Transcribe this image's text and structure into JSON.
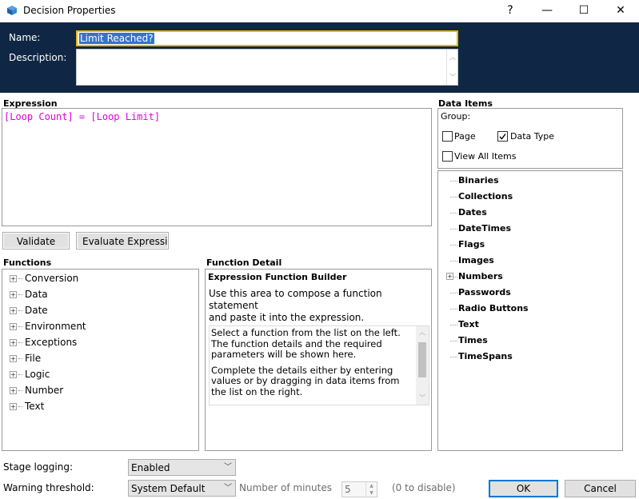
{
  "window": {
    "title": "Decision Properties",
    "help_label": "?",
    "minimize_label": "—",
    "maximize_label": "☐",
    "close_label": "✕"
  },
  "header": {
    "name_label": "Name:",
    "name_value": "Limit Reached?",
    "description_label": "Description:",
    "description_value": ""
  },
  "expression": {
    "label": "Expression",
    "value": "[Loop Count] = [Loop Limit]",
    "validate_label": "Validate",
    "evaluate_label": "Evaluate Expressi"
  },
  "functions": {
    "label": "Functions",
    "items": [
      "Conversion",
      "Data",
      "Date",
      "Environment",
      "Exceptions",
      "File",
      "Logic",
      "Number",
      "Text"
    ]
  },
  "function_detail": {
    "label": "Function Detail",
    "heading": "Expression Function Builder",
    "intro_line1": "Use this area to compose a function statement",
    "intro_line2": "and paste it into the expression.",
    "para1_line1": "Select a function from the list on the left.",
    "para1_line2": "The function details and the required",
    "para1_line3": "parameters will be shown here.",
    "para2_line1": "Complete the details either by entering",
    "para2_line2": "values or by dragging in data items from",
    "para2_line3": "the list on the right."
  },
  "data_items": {
    "label": "Data Items",
    "group_label": "Group:",
    "page_label": "Page",
    "page_checked": false,
    "data_type_label": "Data Type",
    "data_type_checked": true,
    "view_all_label": "View All Items",
    "view_all_checked": false,
    "items": [
      "Binaries",
      "Collections",
      "Dates",
      "DateTimes",
      "Flags",
      "Images",
      "Numbers",
      "Passwords",
      "Radio Buttons",
      "Text",
      "Times",
      "TimeSpans"
    ],
    "expandable_item": "Numbers"
  },
  "footer": {
    "stage_logging_label": "Stage logging:",
    "stage_logging_value": "Enabled",
    "warning_threshold_label": "Warning threshold:",
    "warning_threshold_value": "System Default",
    "number_of_minutes_label": "Number of minutes",
    "minutes_value": "5",
    "disable_hint": "(0 to disable)",
    "ok_label": "OK",
    "cancel_label": "Cancel"
  },
  "colors": {
    "header_bg": "#0f2744",
    "name_border": "#f0b400",
    "selection": "#3173cf",
    "expression_text": "#e000e0",
    "ok_border": "#0078d7"
  },
  "icons": {
    "app": "blueprism-cube-icon",
    "check": "checkmark-icon"
  }
}
